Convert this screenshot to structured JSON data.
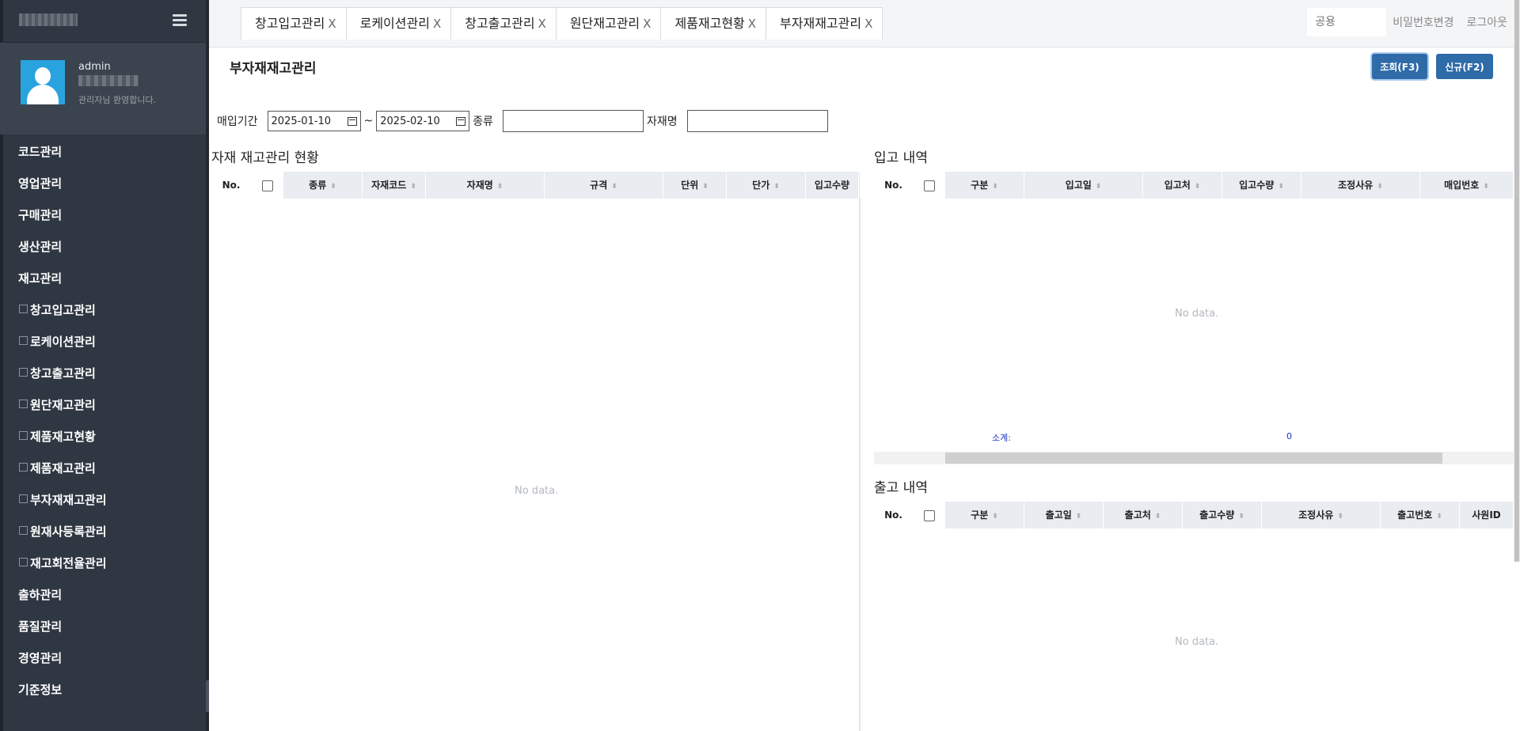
{
  "sidebar": {
    "user_name": "admin",
    "welcome": "관리자님 환영합니다.",
    "menu": [
      "코드관리",
      "영업관리",
      "구매관리",
      "생산관리",
      "재고관리",
      "창고입고관리",
      "로케이션관리",
      "창고출고관리",
      "원단재고관리",
      "제품재고현황",
      "제품재고관리",
      "부자재재고관리",
      "원재사등록관리",
      "재고회전율관리",
      "출하관리",
      "품질관리",
      "경영관리",
      "기준정보"
    ]
  },
  "tabs": [
    "창고입고관리",
    "로케이션관리",
    "창고출고관리",
    "원단재고관리",
    "제품재고현황",
    "부자재재고관리"
  ],
  "tab_close": "X",
  "topbar": {
    "shared_placeholder": "공용",
    "change_password": "비밀번호변경",
    "logout": "로그아웃"
  },
  "page": {
    "title": "부자재재고관리",
    "query_button": "조회(F3)",
    "new_button": "신규(F2)"
  },
  "filters": {
    "period_label": "매입기간",
    "date_from": "2025-01-10",
    "tilde": "~",
    "date_to": "2025-02-10",
    "kind_label": "종류",
    "name_label": "자재명"
  },
  "inventory": {
    "title": "자재 재고관리 현황",
    "columns": [
      "No.",
      "",
      "종류",
      "자재코드",
      "자재명",
      "규격",
      "단위",
      "단가",
      "입고수량"
    ],
    "empty": "No data."
  },
  "receiving": {
    "title": "입고 내역",
    "columns": [
      "No.",
      "",
      "구분",
      "입고일",
      "입고처",
      "입고수량",
      "조정사유",
      "매입번호"
    ],
    "empty": "No data.",
    "subtotal_label": "소계:",
    "subtotal_value": "0"
  },
  "shipping": {
    "title": "출고 내역",
    "columns": [
      "No.",
      "",
      "구분",
      "출고일",
      "출고처",
      "출고수량",
      "조정사유",
      "출고번호",
      "사원ID"
    ],
    "empty": "No data."
  },
  "sort_icon": "⬍"
}
